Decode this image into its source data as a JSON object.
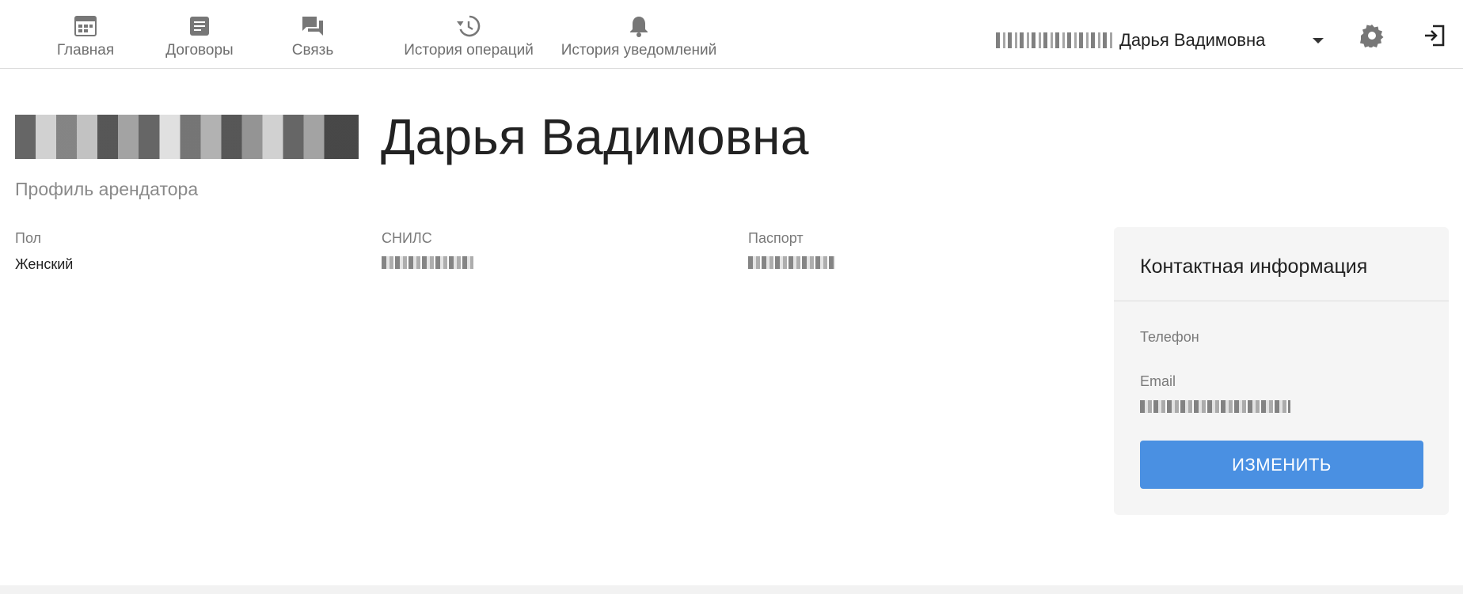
{
  "nav": {
    "items": [
      {
        "label": "Главная",
        "icon": "calendar-icon"
      },
      {
        "label": "Договоры",
        "icon": "document-icon"
      },
      {
        "label": "Связь",
        "icon": "chat-icon"
      },
      {
        "label": "История операций",
        "icon": "history-icon"
      },
      {
        "label": "История уведомлений",
        "icon": "bell-icon"
      }
    ]
  },
  "user_menu": {
    "name_visible": "Дарья Вадимовна",
    "surname_redacted": "█████████"
  },
  "header_icons": {
    "settings": "gear-icon",
    "logout": "logout-icon"
  },
  "profile": {
    "title_visible": "Дарья Вадимовна",
    "title_surname_redacted": "█████████",
    "subtitle": "Профиль арендатора",
    "fields": [
      {
        "label": "Пол",
        "value": "Женский"
      },
      {
        "label": "СНИЛС",
        "value_redacted": "███████████"
      },
      {
        "label": "Паспорт",
        "value_redacted": "██████████"
      }
    ]
  },
  "contact": {
    "title": "Контактная информация",
    "phone_label": "Телефон",
    "email_label": "Email",
    "email_value_redacted": "████████@█████",
    "edit_button": "ИЗМЕНИТЬ"
  },
  "colors": {
    "accent": "#4a90e2",
    "card_bg": "#f5f5f5",
    "muted_text": "#7a7a7a"
  }
}
